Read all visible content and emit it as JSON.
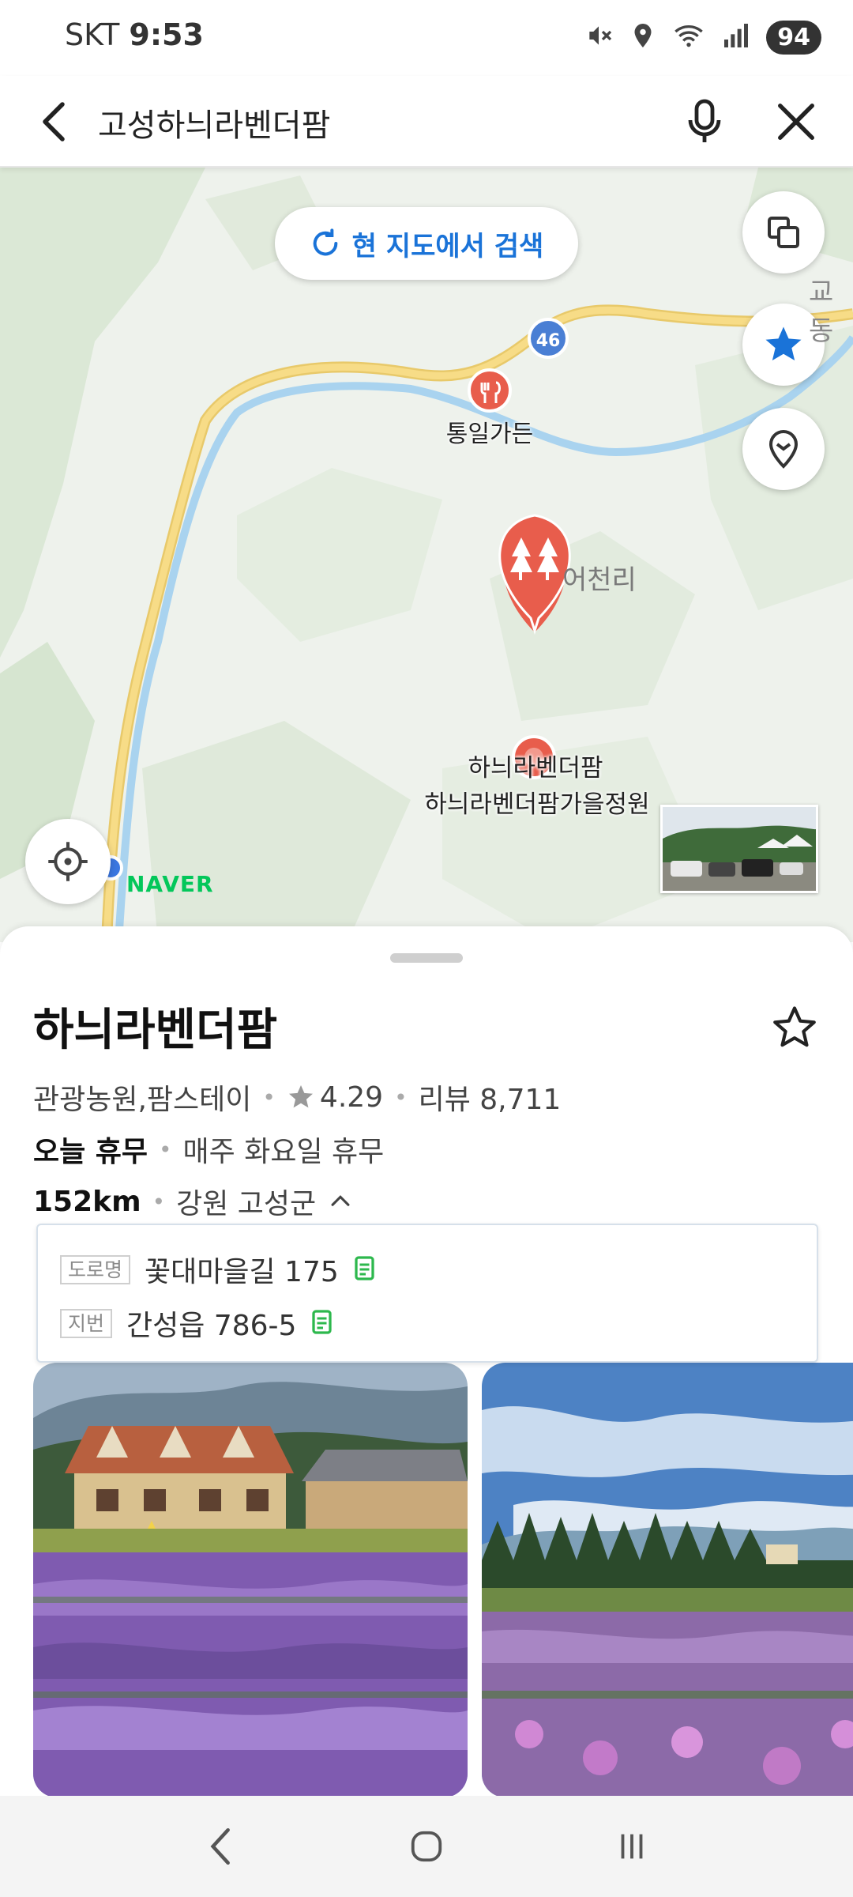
{
  "status_bar": {
    "carrier": "SKT",
    "time": "9:53",
    "battery": "94",
    "icons": [
      "mute-icon",
      "location-icon",
      "wifi-icon",
      "signal-icon"
    ]
  },
  "search": {
    "query": "고성하늬라벤더팜"
  },
  "map": {
    "research_button": "현 지도에서 검색",
    "route_badge": "46",
    "pois": [
      {
        "label": "통일가든",
        "icon": "restaurant-icon",
        "color": "#e85d4c"
      },
      {
        "label": "하늬라벤더팜",
        "icon": "tree-icon",
        "color": "#e85d4c"
      },
      {
        "label": "하늬라벤더팜가을정원",
        "icon": "pin-icon"
      }
    ],
    "region_label": "어천리",
    "edge_label": "교동",
    "logo": "NAVER",
    "colors": {
      "road": "#f7dc87",
      "river": "#a9d3ef",
      "land": "#eef2ec",
      "forest": "#dbe8d6",
      "accent": "#1a73d8"
    }
  },
  "place": {
    "title": "하늬라벤더팜",
    "category": "관광농원,팜스테이",
    "rating": "4.29",
    "reviews": "리뷰 8,711",
    "status": "오늘 휴무",
    "hours_note": "매주 화요일 휴무",
    "distance": "152km",
    "region": "강원 고성군",
    "address": {
      "road_tag": "도로명",
      "road": "꽃대마을길 175",
      "lot_tag": "지번",
      "lot": "간성읍 786-5"
    },
    "colors": {
      "copy_icon": "#2db84d",
      "star": "#999999"
    }
  }
}
